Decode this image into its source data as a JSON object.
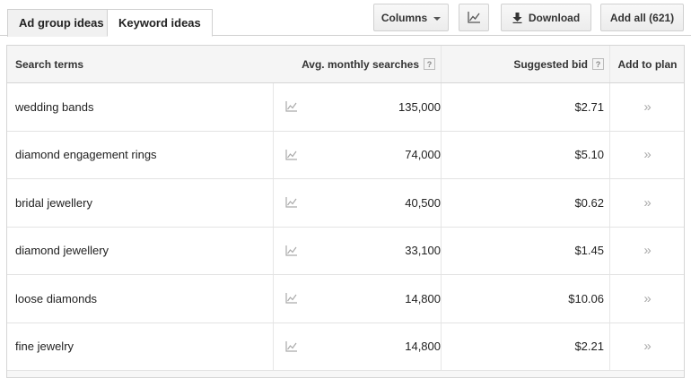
{
  "tabs": [
    {
      "label": "Ad group ideas",
      "active": false
    },
    {
      "label": "Keyword ideas",
      "active": true
    }
  ],
  "toolbar": {
    "columns_label": "Columns",
    "chart_icon": "line-chart-icon",
    "download_label": "Download",
    "add_all_label": "Add all (621)"
  },
  "table": {
    "headers": {
      "search_terms": "Search terms",
      "avg_monthly_searches": "Avg. monthly searches",
      "suggested_bid": "Suggested bid",
      "add_to_plan": "Add to plan",
      "help_glyph": "?"
    },
    "rows": [
      {
        "term": "wedding bands",
        "searches": "135,000",
        "bid": "$2.71",
        "add": "»"
      },
      {
        "term": "diamond engagement rings",
        "searches": "74,000",
        "bid": "$5.10",
        "add": "»"
      },
      {
        "term": "bridal jewellery",
        "searches": "40,500",
        "bid": "$0.62",
        "add": "»"
      },
      {
        "term": "diamond jewellery",
        "searches": "33,100",
        "bid": "$1.45",
        "add": "»"
      },
      {
        "term": "loose diamonds",
        "searches": "14,800",
        "bid": "$10.06",
        "add": "»"
      },
      {
        "term": "fine jewelry",
        "searches": "14,800",
        "bid": "$2.21",
        "add": "»"
      }
    ]
  },
  "colors": {
    "border": "#d5d5d5",
    "header_bg": "#f5f5f5",
    "icon_gray": "#aaaaaa"
  }
}
